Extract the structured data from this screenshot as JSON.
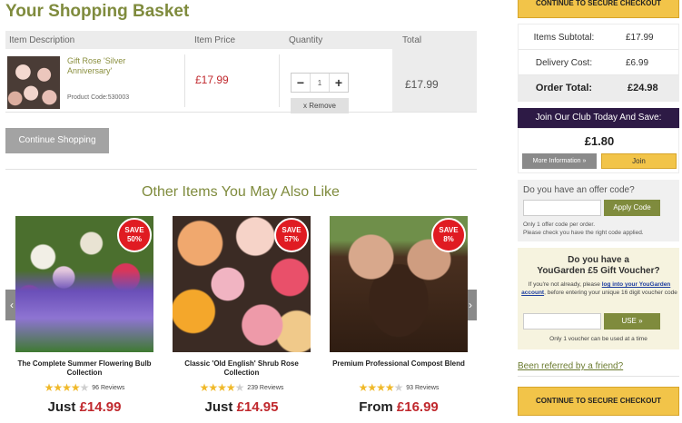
{
  "page_title": "Your Shopping Basket",
  "basket": {
    "headers": {
      "description": "Item Description",
      "price": "Item Price",
      "quantity": "Quantity",
      "total": "Total"
    },
    "item": {
      "name": "Gift Rose 'Silver Anniversary'",
      "product_code": "Product Code:530003",
      "price": "£17.99",
      "quantity": "1",
      "minus": "−",
      "plus": "+",
      "remove": "x Remove",
      "total": "£17.99"
    },
    "continue_label": "Continue Shopping"
  },
  "also_like": {
    "title": "Other Items You May Also Like",
    "prev_arrow": "‹",
    "next_arrow": "›",
    "products": [
      {
        "save_word": "SAVE",
        "save_pct": "50%",
        "name": "The Complete Summer Flowering Bulb Collection",
        "rating_stars": 4,
        "reviews": "96 Reviews",
        "price_prefix": "Just ",
        "price": "£14.99"
      },
      {
        "save_word": "SAVE",
        "save_pct": "57%",
        "name": "Classic 'Old English' Shrub Rose Collection",
        "rating_stars": 4,
        "reviews": "239 Reviews",
        "price_prefix": "Just ",
        "price": "£14.95"
      },
      {
        "save_word": "SAVE",
        "save_pct": "8%",
        "name": "Premium Professional Compost Blend",
        "rating_stars": 4,
        "reviews": "93 Reviews",
        "price_prefix": "From ",
        "price": "£16.99"
      }
    ]
  },
  "sidebar": {
    "checkout_label": "CONTINUE TO SECURE CHECKOUT",
    "summary": {
      "subtotal_label": "Items Subtotal:",
      "subtotal": "£17.99",
      "delivery_label": "Delivery Cost:",
      "delivery": "£6.99",
      "total_label": "Order Total:",
      "total": "£24.98"
    },
    "club": {
      "heading": "Join Our Club Today And Save:",
      "price": "£1.80",
      "more_info": "More Information »",
      "join": "Join"
    },
    "offer": {
      "title": "Do you have an offer code?",
      "apply": "Apply Code",
      "note_1": "Only 1 offer code per order.",
      "note_2": "Please check you have the right code applied."
    },
    "voucher": {
      "title_1": "Do you have a",
      "title_2": "YouGarden £5 Gift Voucher?",
      "note_pre": "If you're not already, please ",
      "note_link": "log into your YouGarden account",
      "note_post": ", before entering your unique 16 digit voucher code",
      "use": "USE »",
      "foot": "Only 1 voucher can be used at a time"
    },
    "referred": "Been referred by a friend?"
  },
  "colors": {
    "accent_olive": "#7f8b3d",
    "price_red": "#c0282d",
    "checkout_yellow": "#f2c449",
    "club_purple": "#2d1a45"
  }
}
